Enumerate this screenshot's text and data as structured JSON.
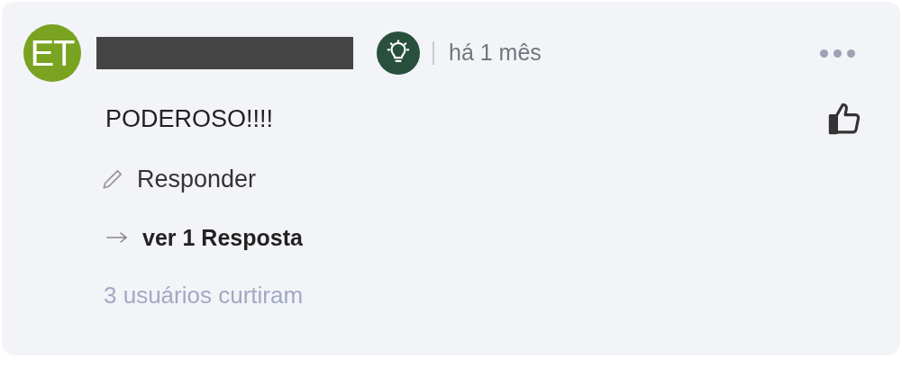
{
  "comment": {
    "avatar_initials": "ET",
    "author_redacted": true,
    "time": "há 1 mês",
    "text": "PODEROSO!!!!",
    "liked": false,
    "reply_label": "Responder",
    "view_replies": "ver 1 Resposta",
    "likes_summary": "3 usuários curtiram"
  }
}
